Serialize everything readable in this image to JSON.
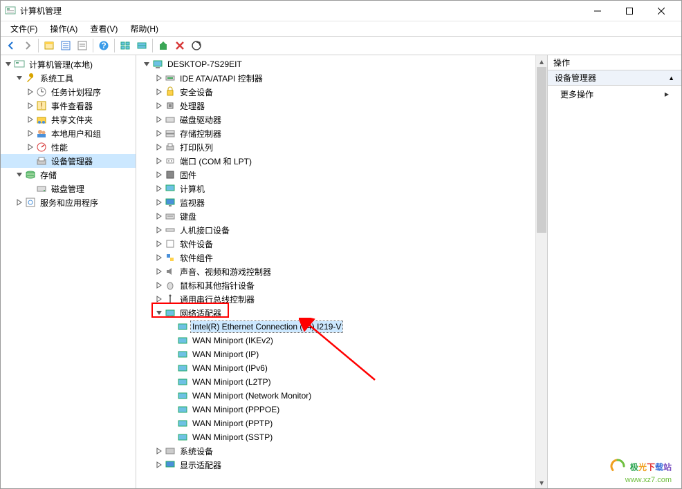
{
  "window": {
    "title": "计算机管理"
  },
  "menus": {
    "file": "文件(F)",
    "action": "操作(A)",
    "view": "查看(V)",
    "help": "帮助(H)"
  },
  "left_tree": {
    "root": "计算机管理(本地)",
    "system_tools": "系统工具",
    "task_scheduler": "任务计划程序",
    "event_viewer": "事件查看器",
    "shared_folders": "共享文件夹",
    "local_users": "本地用户和组",
    "performance": "性能",
    "device_manager": "设备管理器",
    "storage": "存储",
    "disk_mgmt": "磁盘管理",
    "services_apps": "服务和应用程序"
  },
  "center_tree": {
    "root": "DESKTOP-7S29EIT",
    "ide": "IDE ATA/ATAPI 控制器",
    "security": "安全设备",
    "cpu": "处理器",
    "disk_drives": "磁盘驱动器",
    "storage_ctrl": "存储控制器",
    "print_queue": "打印队列",
    "ports": "端口 (COM 和 LPT)",
    "firmware": "固件",
    "computer": "计算机",
    "monitors": "监视器",
    "keyboards": "键盘",
    "hid": "人机接口设备",
    "soft_dev": "软件设备",
    "soft_comp": "软件组件",
    "sound": "声音、视频和游戏控制器",
    "mouse": "鼠标和其他指针设备",
    "usb": "通用串行总线控制器",
    "net_adapters": "网络适配器",
    "net_items": {
      "intel": "Intel(R) Ethernet Connection (14) I219-V",
      "wan_ikev2": "WAN Miniport (IKEv2)",
      "wan_ip": "WAN Miniport (IP)",
      "wan_ipv6": "WAN Miniport (IPv6)",
      "wan_l2tp": "WAN Miniport (L2TP)",
      "wan_monitor": "WAN Miniport (Network Monitor)",
      "wan_pppoe": "WAN Miniport (PPPOE)",
      "wan_pptp": "WAN Miniport (PPTP)",
      "wan_sstp": "WAN Miniport (SSTP)"
    },
    "sys_dev": "系统设备",
    "display": "显示适配器"
  },
  "actions": {
    "header": "操作",
    "section": "设备管理器",
    "more": "更多操作"
  },
  "watermark": {
    "line1": "极光下载站",
    "line2": "www.xz7.com"
  }
}
